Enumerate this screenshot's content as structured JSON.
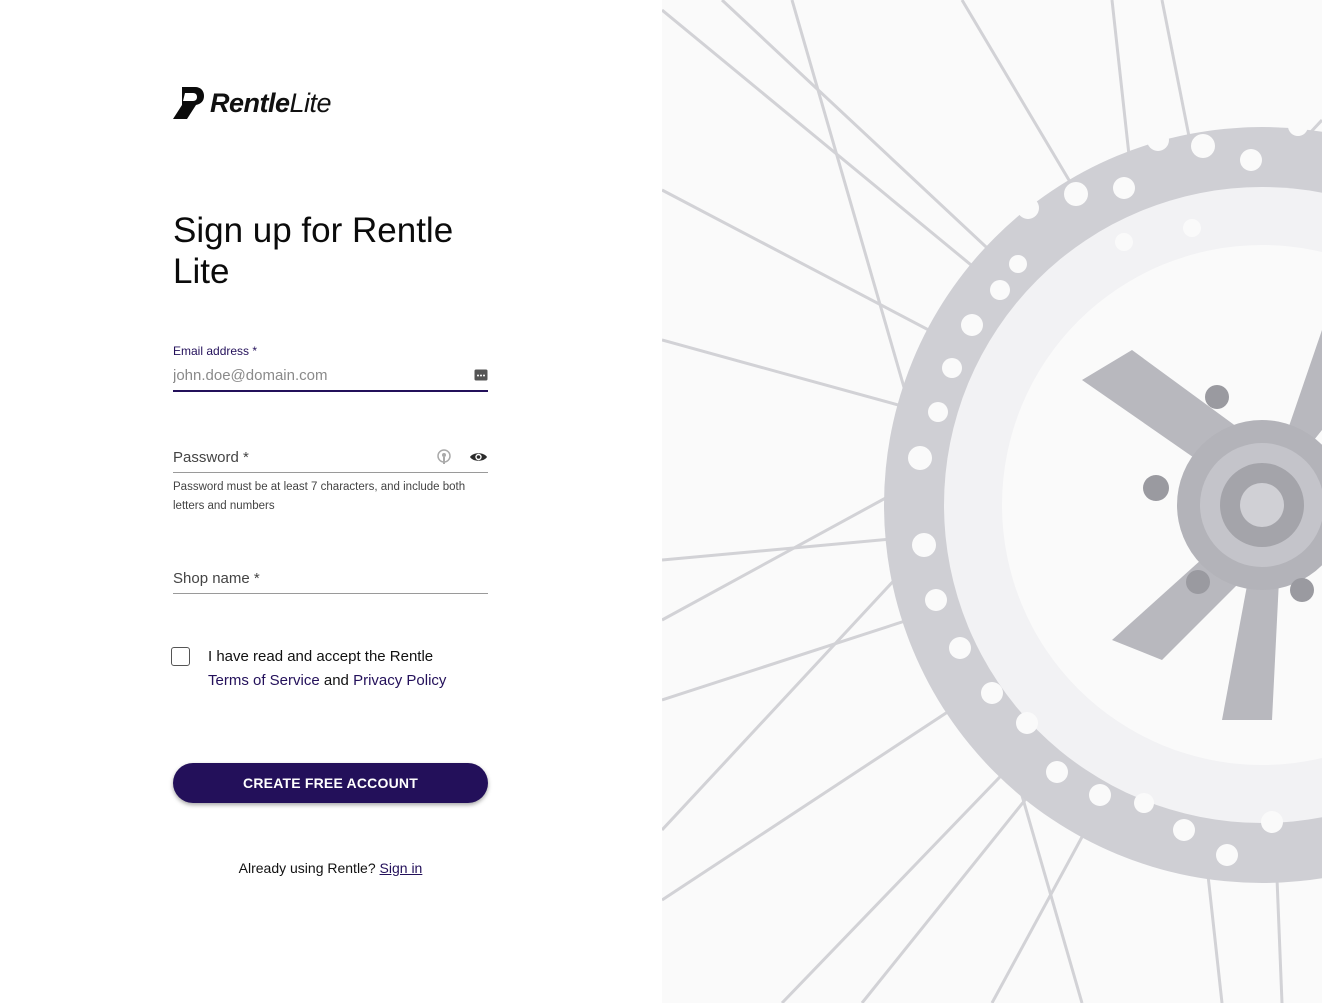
{
  "brand": {
    "name_bold": "Rentle",
    "name_light": "Lite",
    "accent": "#23105a"
  },
  "heading": "Sign up for Rentle Lite",
  "email": {
    "label": "Email address *",
    "placeholder": "john.doe@domain.com",
    "icon": "autofill-key-icon"
  },
  "password": {
    "label": "Password *",
    "helper": "Password must be at least 7 characters, and include both letters and numbers",
    "icons": [
      "password-manager-icon",
      "eye-icon"
    ]
  },
  "shop": {
    "label": "Shop name *"
  },
  "terms": {
    "prefix": "I have read and accept the Rentle",
    "tos": "Terms of Service",
    "and": "and",
    "privacy": "Privacy Policy",
    "checked": false
  },
  "submit": {
    "label": "CREATE FREE ACCOUNT"
  },
  "signin": {
    "prompt": "Already using Rentle?",
    "link": "Sign in"
  },
  "hero": {
    "subject": "bicycle-disc-brake-image"
  }
}
